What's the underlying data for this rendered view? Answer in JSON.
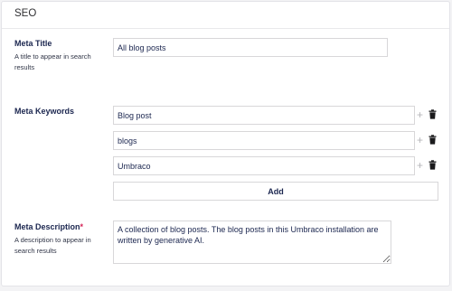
{
  "panel": {
    "title": "SEO"
  },
  "meta_title": {
    "label": "Meta Title",
    "description": "A title to appear in search results",
    "value": "All blog posts"
  },
  "meta_keywords": {
    "label": "Meta Keywords",
    "items": [
      "Blog post",
      "blogs",
      "Umbraco"
    ],
    "add_label": "Add"
  },
  "meta_description": {
    "label": "Meta Description",
    "required_marker": "*",
    "description": "A description to appear in search results",
    "value": "A collection of blog posts. The blog posts in this Umbraco installation are written by generative AI."
  },
  "icons": {
    "add": "plus-icon",
    "delete": "trash-icon"
  },
  "colors": {
    "text": "#1b264f",
    "required": "#d42054",
    "border": "#d8d7d9"
  }
}
